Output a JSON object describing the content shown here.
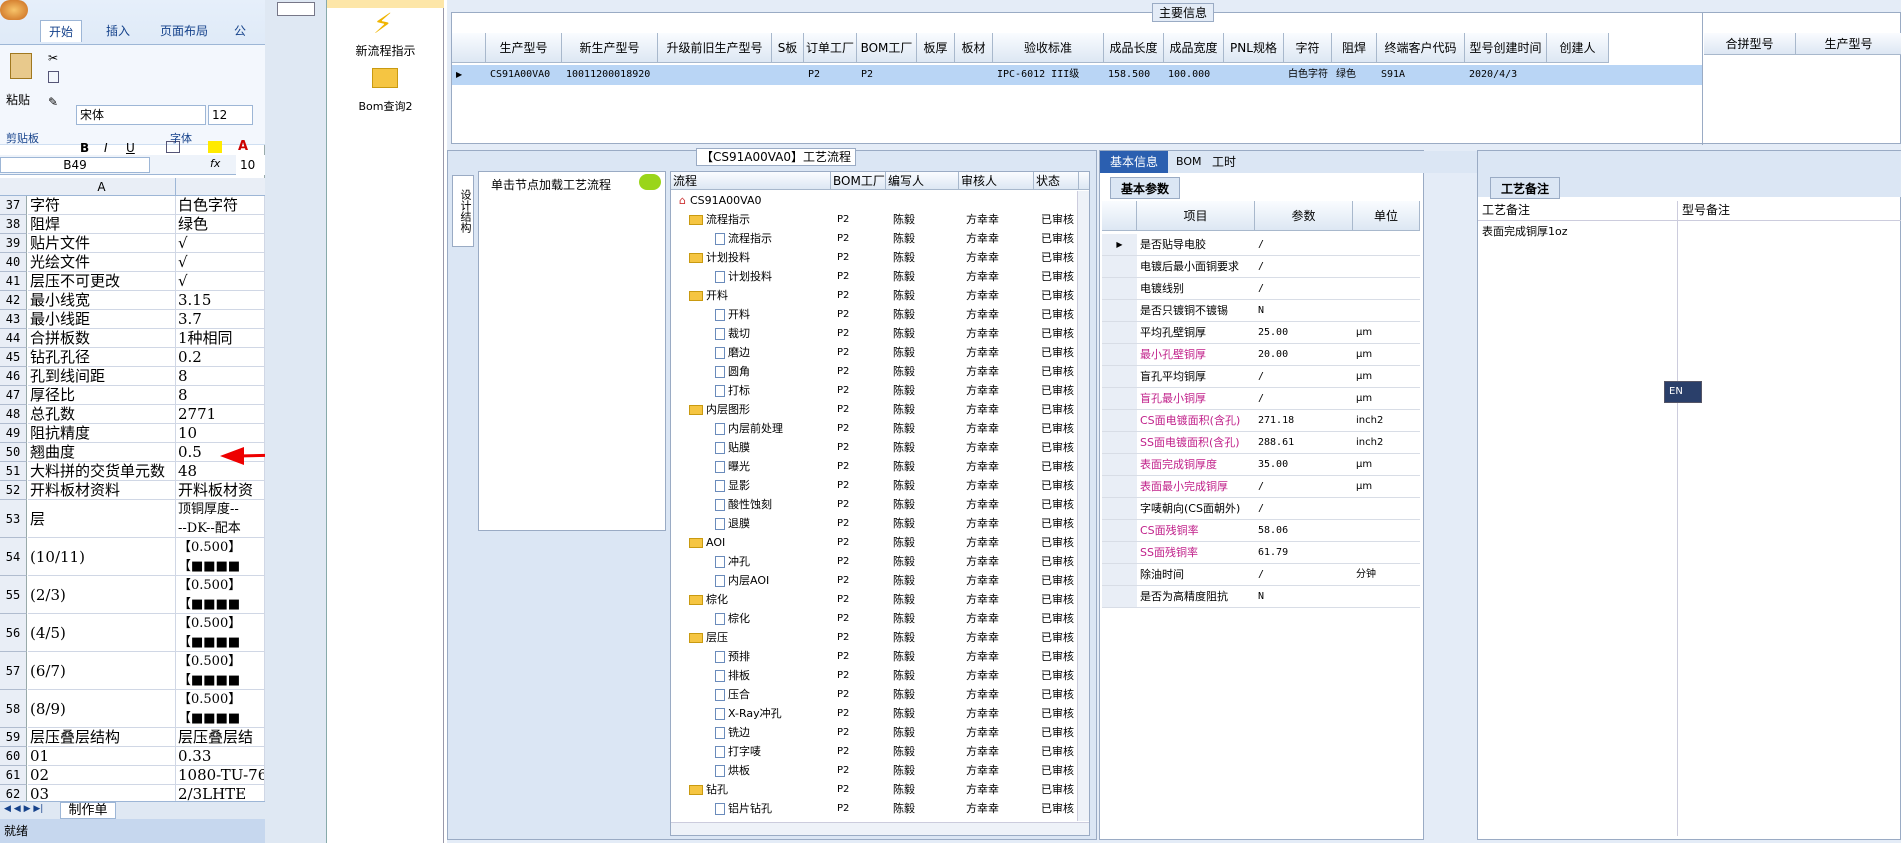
{
  "excel": {
    "tabs": [
      "开始",
      "插入",
      "页面布局",
      "公式"
    ],
    "paste_label": "粘贴",
    "font_name": "宋体",
    "font_size": "12",
    "groups": [
      "剪贴板",
      "字体"
    ],
    "name_box": "B49",
    "fx_label": "fx",
    "fx_value": "10",
    "col_header": "A",
    "rows": [
      {
        "n": "37",
        "a": "字符",
        "b": "白色字符"
      },
      {
        "n": "38",
        "a": "阻焊",
        "b": "绿色"
      },
      {
        "n": "39",
        "a": "贴片文件",
        "b": "√"
      },
      {
        "n": "40",
        "a": "光绘文件",
        "b": "√"
      },
      {
        "n": "41",
        "a": "层压不可更改",
        "b": "√"
      },
      {
        "n": "42",
        "a": "最小线宽",
        "b": "3.15"
      },
      {
        "n": "43",
        "a": "最小线距",
        "b": "3.7"
      },
      {
        "n": "44",
        "a": "合拼板数",
        "b": "1种相同"
      },
      {
        "n": "45",
        "a": "钻孔孔径",
        "b": "0.2"
      },
      {
        "n": "46",
        "a": "孔到线间距",
        "b": "8"
      },
      {
        "n": "47",
        "a": "厚径比",
        "b": "8"
      },
      {
        "n": "48",
        "a": "总孔数",
        "b": "2771"
      },
      {
        "n": "49",
        "a": "阻抗精度",
        "b": "10"
      },
      {
        "n": "50",
        "a": "翘曲度",
        "b": "0.5"
      },
      {
        "n": "51",
        "a": "大料拼的交货单元数",
        "b": "48"
      },
      {
        "n": "52",
        "a": "开料板材资料",
        "b": "开料板材资"
      }
    ],
    "row53": {
      "n": "53",
      "a": "层",
      "b1": "顶铜厚度--",
      "b2": "--DK--配本"
    },
    "tall_rows": [
      {
        "n": "54",
        "a": "(10/11)",
        "b": "【0.500】"
      },
      {
        "n": "55",
        "a": "(2/3)",
        "b": "【0.500】"
      },
      {
        "n": "56",
        "a": "(4/5)",
        "b": "【0.500】"
      },
      {
        "n": "57",
        "a": "(6/7)",
        "b": "【0.500】"
      },
      {
        "n": "58",
        "a": "(8/9)",
        "b": "【0.500】"
      }
    ],
    "tail_rows": [
      {
        "n": "59",
        "a": "层压叠层结构",
        "b": "层压叠层结"
      },
      {
        "n": "60",
        "a": "01",
        "b": "0.33"
      },
      {
        "n": "61",
        "a": "02",
        "b": "1080-TU-76"
      },
      {
        "n": "62",
        "a": "03",
        "b": "2/3LHTE"
      }
    ],
    "sheet_tab": "制作单",
    "status": "就绪"
  },
  "nav": {
    "new_process": "新流程指示",
    "bom_query": "Bom查询2"
  },
  "main_info": {
    "title": "主要信息",
    "headers": [
      "生产型号",
      "新生产型号",
      "升级前旧生产型号",
      "S板",
      "订单工厂",
      "BOM工厂",
      "板厚",
      "板材",
      "验收标准",
      "成品长度",
      "成品宽度",
      "PNL规格",
      "字符",
      "阻焊",
      "终端客户代码",
      "型号创建时间",
      "创建人"
    ],
    "row": [
      "CS91A00VA0",
      "10011200018920",
      "",
      "",
      "P2",
      "P2",
      "",
      "",
      "IPC-6012 III级",
      "158.500",
      "100.000",
      "",
      "白色字符",
      "绿色",
      "S91A",
      "2020/4/3",
      ""
    ],
    "side_headers": [
      "合拼型号",
      "生产型号"
    ]
  },
  "process": {
    "title": "【CS91A00VA0】工艺流程",
    "vertical_tab": "设计结构",
    "load_hint": "单击节点加载工艺流程",
    "headers": [
      "流程",
      "BOM工厂",
      "编写人",
      "审核人",
      "状态"
    ],
    "root": "CS91A00VA0",
    "rows": [
      {
        "name": "流程指示",
        "lvl": 1,
        "folder": true
      },
      {
        "name": "流程指示",
        "lvl": 2,
        "folder": false
      },
      {
        "name": "计划投料",
        "lvl": 1,
        "folder": true
      },
      {
        "name": "计划投料",
        "lvl": 2,
        "folder": false
      },
      {
        "name": "开料",
        "lvl": 1,
        "folder": true
      },
      {
        "name": "开料",
        "lvl": 2,
        "folder": false
      },
      {
        "name": "裁切",
        "lvl": 2,
        "folder": false
      },
      {
        "name": "磨边",
        "lvl": 2,
        "folder": false
      },
      {
        "name": "圆角",
        "lvl": 2,
        "folder": false
      },
      {
        "name": "打标",
        "lvl": 2,
        "folder": false
      },
      {
        "name": "内层图形",
        "lvl": 1,
        "folder": true
      },
      {
        "name": "内层前处理",
        "lvl": 2,
        "folder": false
      },
      {
        "name": "贴膜",
        "lvl": 2,
        "folder": false
      },
      {
        "name": "曝光",
        "lvl": 2,
        "folder": false
      },
      {
        "name": "显影",
        "lvl": 2,
        "folder": false
      },
      {
        "name": "酸性蚀刻",
        "lvl": 2,
        "folder": false
      },
      {
        "name": "退膜",
        "lvl": 2,
        "folder": false
      },
      {
        "name": "AOI",
        "lvl": 1,
        "folder": true
      },
      {
        "name": "冲孔",
        "lvl": 2,
        "folder": false
      },
      {
        "name": "内层AOI",
        "lvl": 2,
        "folder": false
      },
      {
        "name": "棕化",
        "lvl": 1,
        "folder": true
      },
      {
        "name": "棕化",
        "lvl": 2,
        "folder": false
      },
      {
        "name": "层压",
        "lvl": 1,
        "folder": true
      },
      {
        "name": "预排",
        "lvl": 2,
        "folder": false
      },
      {
        "name": "排板",
        "lvl": 2,
        "folder": false
      },
      {
        "name": "压合",
        "lvl": 2,
        "folder": false
      },
      {
        "name": "X-Ray冲孔",
        "lvl": 2,
        "folder": false
      },
      {
        "name": "铣边",
        "lvl": 2,
        "folder": false
      },
      {
        "name": "打字唛",
        "lvl": 2,
        "folder": false
      },
      {
        "name": "烘板",
        "lvl": 2,
        "folder": false
      },
      {
        "name": "钻孔",
        "lvl": 1,
        "folder": true
      },
      {
        "name": "铝片钻孔",
        "lvl": 2,
        "folder": false
      }
    ],
    "bom": "P2",
    "writer": "陈毅",
    "reviewer": "方幸幸",
    "status": "已审核"
  },
  "detail": {
    "tabs": [
      "基本信息",
      "BOM",
      "工时"
    ],
    "sub_tab": "基本参数",
    "headers": [
      "项目",
      "参数",
      "单位"
    ],
    "rows": [
      {
        "item": "是否贴导电胶",
        "val": "/",
        "unit": "",
        "pink": false
      },
      {
        "item": "电镀后最小面铜要求",
        "val": "/",
        "unit": "",
        "pink": false
      },
      {
        "item": "电镀线别",
        "val": "/",
        "unit": "",
        "pink": false
      },
      {
        "item": "是否只镀铜不镀锡",
        "val": "N",
        "unit": "",
        "pink": false
      },
      {
        "item": "平均孔壁铜厚",
        "val": "25.00",
        "unit": "μm",
        "pink": false
      },
      {
        "item": "最小孔壁铜厚",
        "val": "20.00",
        "unit": "μm",
        "pink": true
      },
      {
        "item": "盲孔平均铜厚",
        "val": "/",
        "unit": "μm",
        "pink": false
      },
      {
        "item": "盲孔最小铜厚",
        "val": "/",
        "unit": "μm",
        "pink": true
      },
      {
        "item": "CS面电镀面积(含孔)",
        "val": "271.18",
        "unit": "inch2",
        "pink": true
      },
      {
        "item": "SS面电镀面积(含孔)",
        "val": "288.61",
        "unit": "inch2",
        "pink": true
      },
      {
        "item": "表面完成铜厚度",
        "val": "35.00",
        "unit": "μm",
        "pink": true
      },
      {
        "item": "表面最小完成铜厚",
        "val": "/",
        "unit": "μm",
        "pink": true
      },
      {
        "item": "字唛朝向(CS面朝外)",
        "val": "/",
        "unit": "",
        "pink": false
      },
      {
        "item": "CS面残铜率",
        "val": "58.06",
        "unit": "",
        "pink": true
      },
      {
        "item": "SS面残铜率",
        "val": "61.79",
        "unit": "",
        "pink": true
      },
      {
        "item": "除油时间",
        "val": "/",
        "unit": "分钟",
        "pink": false
      },
      {
        "item": "是否为高精度阻抗",
        "val": "N",
        "unit": "",
        "pink": false
      }
    ]
  },
  "remarks": {
    "tab": "工艺备注",
    "headers": [
      "工艺备注",
      "型号备注"
    ],
    "text": "表面完成铜厚1oz"
  },
  "lang": {
    "code": "EN"
  }
}
